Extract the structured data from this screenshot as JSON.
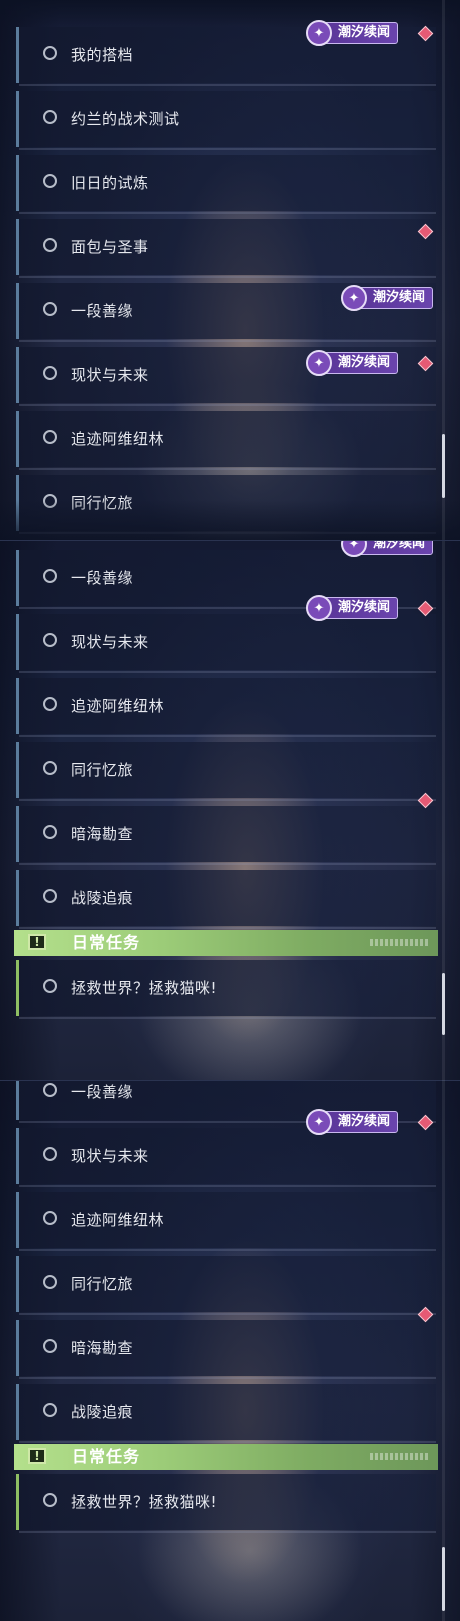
{
  "badge_label": "潮汐续闻",
  "badge_emblem": "compass-emblem-icon",
  "colors": {
    "item_accent": "#5b7c9c",
    "daily_accent": "#8fbf63",
    "badge_bg": "#6a44ad",
    "alert_diamond": "#e55a74",
    "section_header": "#b4e08c"
  },
  "icons": {
    "radio": "empty-circle-radio-icon",
    "alert": "red-diamond-icon",
    "section": "exclamation-box-icon"
  },
  "screen1": {
    "quests": [
      "我的搭档",
      "约兰的战术测试",
      "旧日的试炼",
      "面包与圣事",
      "一段善缘",
      "现状与未来",
      "追迹阿维纽林",
      "同行忆旅"
    ]
  },
  "screen2": {
    "quests": [
      "一段善缘",
      "现状与未来",
      "追迹阿维纽林",
      "同行忆旅",
      "暗海勘查",
      "战陵追痕"
    ],
    "section_title": "日常任务",
    "daily_quests": [
      "拯救世界？拯救猫咪!"
    ]
  },
  "screen3": {
    "quests": [
      "一段善缘",
      "现状与未来",
      "追迹阿维纽林",
      "同行忆旅",
      "暗海勘查",
      "战陵追痕"
    ],
    "section_title": "日常任务",
    "daily_quests": [
      "拯救世界？拯救猫咪!"
    ]
  }
}
